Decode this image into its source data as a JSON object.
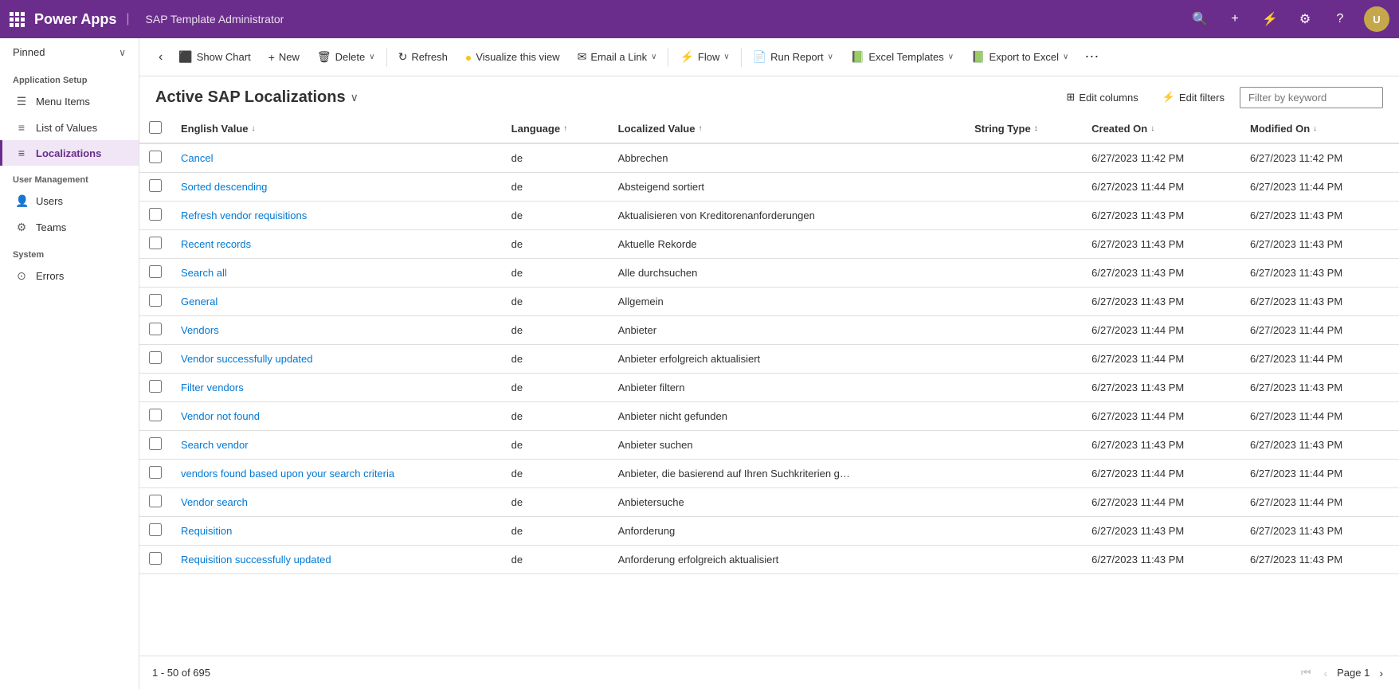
{
  "topBar": {
    "appName": "Power Apps",
    "appTitle": "SAP Template Administrator",
    "avatarInitials": "U"
  },
  "sidebar": {
    "pinnedLabel": "Pinned",
    "sections": [
      {
        "label": "Application Setup",
        "items": [
          {
            "id": "menu-items",
            "label": "Menu Items",
            "icon": "☰",
            "active": false
          },
          {
            "id": "list-of-values",
            "label": "List of Values",
            "icon": "≡",
            "active": false
          },
          {
            "id": "localizations",
            "label": "Localizations",
            "icon": "≡",
            "active": true
          }
        ]
      },
      {
        "label": "User Management",
        "items": [
          {
            "id": "users",
            "label": "Users",
            "icon": "👤",
            "active": false
          },
          {
            "id": "teams",
            "label": "Teams",
            "icon": "⚙",
            "active": false
          }
        ]
      },
      {
        "label": "System",
        "items": [
          {
            "id": "errors",
            "label": "Errors",
            "icon": "⊙",
            "active": false
          }
        ]
      }
    ]
  },
  "commandBar": {
    "backButton": "‹",
    "buttons": [
      {
        "id": "show-chart",
        "icon": "📊",
        "label": "Show Chart",
        "hasChevron": false
      },
      {
        "id": "new",
        "icon": "+",
        "label": "New",
        "hasChevron": false
      },
      {
        "id": "delete",
        "icon": "🗑",
        "label": "Delete",
        "hasChevron": true
      },
      {
        "id": "refresh",
        "icon": "↻",
        "label": "Refresh",
        "hasChevron": false
      },
      {
        "id": "visualize",
        "icon": "🟡",
        "label": "Visualize this view",
        "hasChevron": false
      },
      {
        "id": "email-link",
        "icon": "✉",
        "label": "Email a Link",
        "hasChevron": true
      },
      {
        "id": "flow",
        "icon": "⚡",
        "label": "Flow",
        "hasChevron": true
      },
      {
        "id": "run-report",
        "icon": "📄",
        "label": "Run Report",
        "hasChevron": true
      },
      {
        "id": "excel-templates",
        "icon": "📗",
        "label": "Excel Templates",
        "hasChevron": true
      },
      {
        "id": "export-to-excel",
        "icon": "📗",
        "label": "Export to Excel",
        "hasChevron": true
      }
    ],
    "moreButton": "⋯"
  },
  "viewHeader": {
    "title": "Active SAP Localizations",
    "editColumnsLabel": "Edit columns",
    "editFiltersLabel": "Edit filters",
    "filterPlaceholder": "Filter by keyword"
  },
  "table": {
    "columns": [
      {
        "id": "english-value",
        "label": "English Value",
        "sortable": true,
        "sortDir": "desc"
      },
      {
        "id": "language",
        "label": "Language",
        "sortable": true,
        "sortDir": "asc"
      },
      {
        "id": "localized-value",
        "label": "Localized Value",
        "sortable": true,
        "sortDir": "asc"
      },
      {
        "id": "string-type",
        "label": "String Type",
        "sortable": true
      },
      {
        "id": "created-on",
        "label": "Created On",
        "sortable": true,
        "sortDir": "desc"
      },
      {
        "id": "modified-on",
        "label": "Modified On",
        "sortable": true,
        "sortDir": "desc"
      }
    ],
    "rows": [
      {
        "englishValue": "Cancel",
        "language": "de",
        "localizedValue": "Abbrechen",
        "stringType": "",
        "createdOn": "6/27/2023 11:42 PM",
        "modifiedOn": "6/27/2023 11:42 PM"
      },
      {
        "englishValue": "Sorted descending",
        "language": "de",
        "localizedValue": "Absteigend sortiert",
        "stringType": "",
        "createdOn": "6/27/2023 11:44 PM",
        "modifiedOn": "6/27/2023 11:44 PM"
      },
      {
        "englishValue": "Refresh vendor requisitions",
        "language": "de",
        "localizedValue": "Aktualisieren von Kreditorenanforderungen",
        "stringType": "",
        "createdOn": "6/27/2023 11:43 PM",
        "modifiedOn": "6/27/2023 11:43 PM"
      },
      {
        "englishValue": "Recent records",
        "language": "de",
        "localizedValue": "Aktuelle Rekorde",
        "stringType": "",
        "createdOn": "6/27/2023 11:43 PM",
        "modifiedOn": "6/27/2023 11:43 PM"
      },
      {
        "englishValue": "Search all",
        "language": "de",
        "localizedValue": "Alle durchsuchen",
        "stringType": "",
        "createdOn": "6/27/2023 11:43 PM",
        "modifiedOn": "6/27/2023 11:43 PM"
      },
      {
        "englishValue": "General",
        "language": "de",
        "localizedValue": "Allgemein",
        "stringType": "",
        "createdOn": "6/27/2023 11:43 PM",
        "modifiedOn": "6/27/2023 11:43 PM"
      },
      {
        "englishValue": "Vendors",
        "language": "de",
        "localizedValue": "Anbieter",
        "stringType": "",
        "createdOn": "6/27/2023 11:44 PM",
        "modifiedOn": "6/27/2023 11:44 PM"
      },
      {
        "englishValue": "Vendor successfully updated",
        "language": "de",
        "localizedValue": "Anbieter erfolgreich aktualisiert",
        "stringType": "",
        "createdOn": "6/27/2023 11:44 PM",
        "modifiedOn": "6/27/2023 11:44 PM"
      },
      {
        "englishValue": "Filter vendors",
        "language": "de",
        "localizedValue": "Anbieter filtern",
        "stringType": "",
        "createdOn": "6/27/2023 11:43 PM",
        "modifiedOn": "6/27/2023 11:43 PM"
      },
      {
        "englishValue": "Vendor not found",
        "language": "de",
        "localizedValue": "Anbieter nicht gefunden",
        "stringType": "",
        "createdOn": "6/27/2023 11:44 PM",
        "modifiedOn": "6/27/2023 11:44 PM"
      },
      {
        "englishValue": "Search vendor",
        "language": "de",
        "localizedValue": "Anbieter suchen",
        "stringType": "",
        "createdOn": "6/27/2023 11:43 PM",
        "modifiedOn": "6/27/2023 11:43 PM"
      },
      {
        "englishValue": "vendors found based upon your search criteria",
        "language": "de",
        "localizedValue": "Anbieter, die basierend auf Ihren Suchkriterien g…",
        "stringType": "",
        "createdOn": "6/27/2023 11:44 PM",
        "modifiedOn": "6/27/2023 11:44 PM"
      },
      {
        "englishValue": "Vendor search",
        "language": "de",
        "localizedValue": "Anbietersuche",
        "stringType": "",
        "createdOn": "6/27/2023 11:44 PM",
        "modifiedOn": "6/27/2023 11:44 PM"
      },
      {
        "englishValue": "Requisition",
        "language": "de",
        "localizedValue": "Anforderung",
        "stringType": "",
        "createdOn": "6/27/2023 11:43 PM",
        "modifiedOn": "6/27/2023 11:43 PM"
      },
      {
        "englishValue": "Requisition successfully updated",
        "language": "de",
        "localizedValue": "Anforderung erfolgreich aktualisiert",
        "stringType": "",
        "createdOn": "6/27/2023 11:43 PM",
        "modifiedOn": "6/27/2023 11:43 PM"
      }
    ]
  },
  "footer": {
    "rangeLabel": "1 - 50 of 695",
    "pageLabel": "Page 1"
  }
}
